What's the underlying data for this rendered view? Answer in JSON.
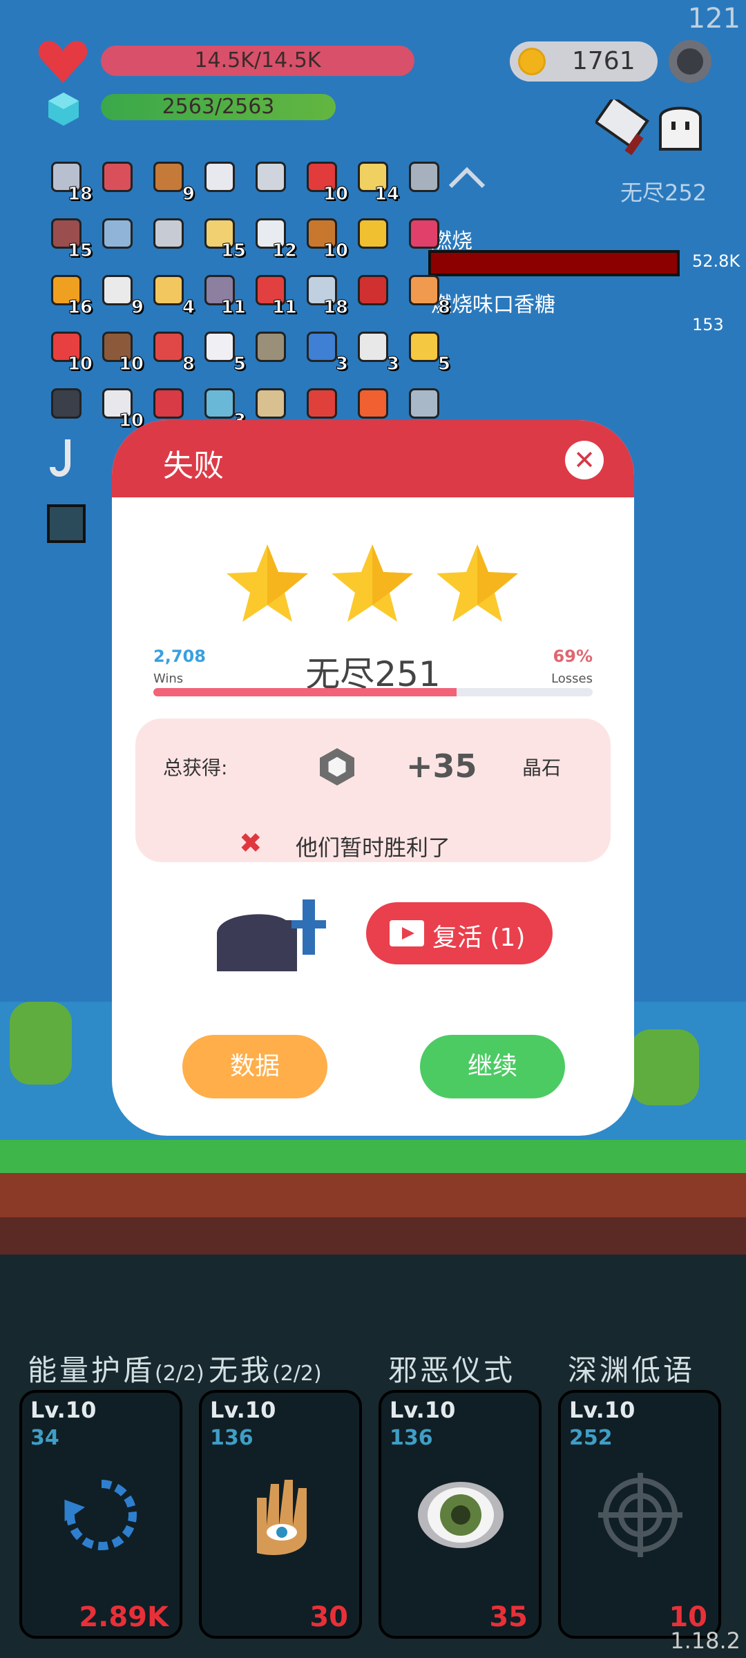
{
  "hud": {
    "hp_text": "14.5K/14.5K",
    "mp_text": "2563/2563",
    "coins": "1761",
    "top_right_number": "121",
    "version": "1.18.2"
  },
  "stage": {
    "current": "无尽252",
    "effect1": "燃烧",
    "effect1_value": "52.8K",
    "effect2": "燃烧味口香糖",
    "effect2_value": "153"
  },
  "items": [
    {
      "icon": "sword-icon",
      "count": "18"
    },
    {
      "icon": "shield-icon",
      "count": ""
    },
    {
      "icon": "target-icon",
      "count": "9"
    },
    {
      "icon": "checklist-icon",
      "count": ""
    },
    {
      "icon": "blade-icon",
      "count": ""
    },
    {
      "icon": "apple-icon",
      "count": "10"
    },
    {
      "icon": "flower-icon",
      "count": "14"
    },
    {
      "icon": "axe-icon",
      "count": ""
    },
    {
      "icon": "door-icon",
      "count": "15"
    },
    {
      "icon": "frame-icon",
      "count": ""
    },
    {
      "icon": "helmet-icon",
      "count": ""
    },
    {
      "icon": "clipboard-icon",
      "count": "15"
    },
    {
      "icon": "mail-icon",
      "count": "12"
    },
    {
      "icon": "book-icon",
      "count": "10"
    },
    {
      "icon": "ring-icon",
      "count": ""
    },
    {
      "icon": "gem-icon",
      "count": ""
    },
    {
      "icon": "shell-icon",
      "count": "16"
    },
    {
      "icon": "dice-icon",
      "count": "9"
    },
    {
      "icon": "map-icon",
      "count": "4"
    },
    {
      "icon": "spike-icon",
      "count": "11"
    },
    {
      "icon": "strawberry-icon",
      "count": "11"
    },
    {
      "icon": "needle-icon",
      "count": "18"
    },
    {
      "icon": "magnet-icon",
      "count": ""
    },
    {
      "icon": "icecream-icon",
      "count": "8"
    },
    {
      "icon": "watermelon-icon",
      "count": "10"
    },
    {
      "icon": "coconut-icon",
      "count": "10"
    },
    {
      "icon": "sock-icon",
      "count": "8"
    },
    {
      "icon": "cards-icon",
      "count": "5"
    },
    {
      "icon": "meteor-icon",
      "count": ""
    },
    {
      "icon": "star-card-icon",
      "count": "3"
    },
    {
      "icon": "pill-icon",
      "count": "3"
    },
    {
      "icon": "cheese-icon",
      "count": "5"
    },
    {
      "icon": "skull-book-icon",
      "count": ""
    },
    {
      "icon": "ghost-icon",
      "count": "10"
    },
    {
      "icon": "heart-icon",
      "count": ""
    },
    {
      "icon": "potion-icon",
      "count": "3"
    },
    {
      "icon": "scroll-icon",
      "count": ""
    },
    {
      "icon": "gift-icon",
      "count": ""
    },
    {
      "icon": "fire-icon",
      "count": ""
    },
    {
      "icon": "robe-icon",
      "count": ""
    }
  ],
  "modal": {
    "title": "失败",
    "close": "✕",
    "wins": "2,708",
    "wins_label": "Wins",
    "losses_pct": "69%",
    "losses_label": "Losses",
    "level": "无尽251",
    "progress": 0.69,
    "total_label": "总获得:",
    "reward_value": "+35",
    "reward_unit": "晶石",
    "result_text": "他们暂时胜利了",
    "revive_label": "复活 (1)",
    "data_button": "数据",
    "continue_button": "继续",
    "colors": {
      "header": "#dd3a47",
      "data": "#ffae4a",
      "continue": "#4ccb63"
    }
  },
  "skills": [
    {
      "title": "能量护盾",
      "count": "(2/2)",
      "level": "Lv.10",
      "cost": "34",
      "value": "2.89K",
      "icon": "refresh-icon"
    },
    {
      "title": "无我",
      "count": "(2/2)",
      "level": "Lv.10",
      "cost": "136",
      "value": "30",
      "icon": "hand-eye-icon"
    },
    {
      "title": "邪恶仪式",
      "count": "",
      "level": "Lv.10",
      "cost": "136",
      "value": "35",
      "icon": "eye-icon"
    },
    {
      "title": "深渊低语",
      "count": "",
      "level": "Lv.10",
      "cost": "252",
      "value": "10",
      "icon": "crosshair-icon"
    }
  ]
}
